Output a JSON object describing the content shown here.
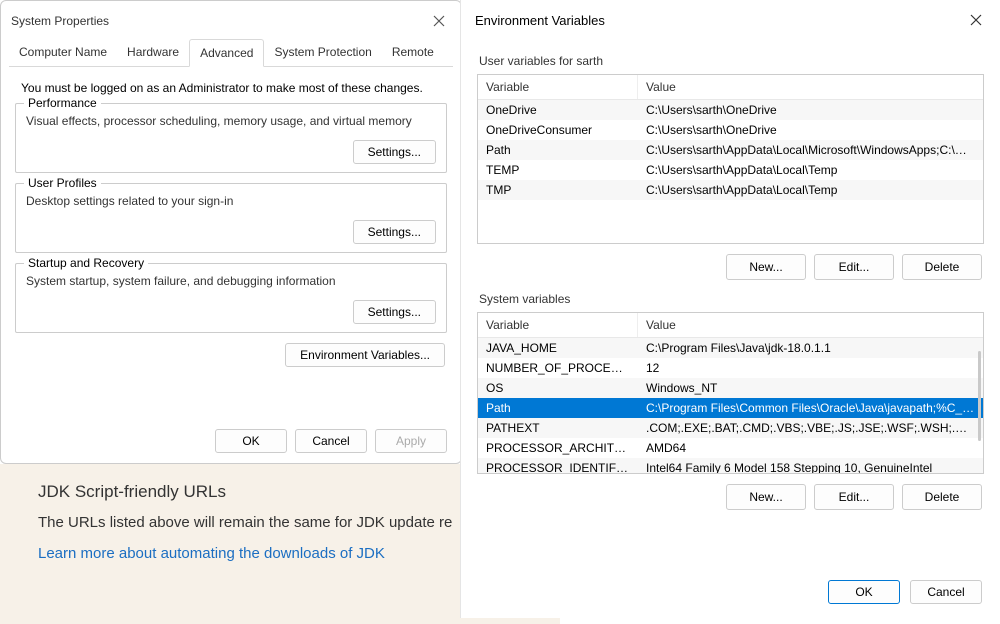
{
  "sysprop": {
    "title": "System Properties",
    "tabs": [
      "Computer Name",
      "Hardware",
      "Advanced",
      "System Protection",
      "Remote"
    ],
    "active_tab": 2,
    "admin_note": "You must be logged on as an Administrator to make most of these changes.",
    "groups": {
      "performance": {
        "legend": "Performance",
        "desc": "Visual effects, processor scheduling, memory usage, and virtual memory",
        "button": "Settings..."
      },
      "user_profiles": {
        "legend": "User Profiles",
        "desc": "Desktop settings related to your sign-in",
        "button": "Settings..."
      },
      "startup": {
        "legend": "Startup and Recovery",
        "desc": "System startup, system failure, and debugging information",
        "button": "Settings..."
      }
    },
    "env_button": "Environment Variables...",
    "buttons": {
      "ok": "OK",
      "cancel": "Cancel",
      "apply": "Apply"
    }
  },
  "bg": {
    "heading": "JDK Script-friendly URLs",
    "text": "The URLs listed above will remain the same for JDK update re",
    "link": "Learn more about automating the downloads of JDK"
  },
  "env": {
    "title": "Environment Variables",
    "user_section": "User variables for sarth",
    "sys_section": "System variables",
    "headers": {
      "variable": "Variable",
      "value": "Value"
    },
    "user_vars": [
      {
        "variable": "OneDrive",
        "value": "C:\\Users\\sarth\\OneDrive"
      },
      {
        "variable": "OneDriveConsumer",
        "value": "C:\\Users\\sarth\\OneDrive"
      },
      {
        "variable": "Path",
        "value": "C:\\Users\\sarth\\AppData\\Local\\Microsoft\\WindowsApps;C:\\Us..."
      },
      {
        "variable": "TEMP",
        "value": "C:\\Users\\sarth\\AppData\\Local\\Temp"
      },
      {
        "variable": "TMP",
        "value": "C:\\Users\\sarth\\AppData\\Local\\Temp"
      }
    ],
    "sys_vars": [
      {
        "variable": "JAVA_HOME",
        "value": "C:\\Program Files\\Java\\jdk-18.0.1.1"
      },
      {
        "variable": "NUMBER_OF_PROCESSORS",
        "value": "12"
      },
      {
        "variable": "OS",
        "value": "Windows_NT"
      },
      {
        "variable": "Path",
        "value": "C:\\Program Files\\Common Files\\Oracle\\Java\\javapath;%C_EM...",
        "selected": true
      },
      {
        "variable": "PATHEXT",
        "value": ".COM;.EXE;.BAT;.CMD;.VBS;.VBE;.JS;.JSE;.WSF;.WSH;.MSC"
      },
      {
        "variable": "PROCESSOR_ARCHITECTU...",
        "value": "AMD64"
      },
      {
        "variable": "PROCESSOR_IDENTIFIER",
        "value": "Intel64 Family 6 Model 158 Stepping 10, GenuineIntel"
      }
    ],
    "buttons": {
      "new": "New...",
      "edit": "Edit...",
      "delete": "Delete",
      "ok": "OK",
      "cancel": "Cancel"
    }
  }
}
